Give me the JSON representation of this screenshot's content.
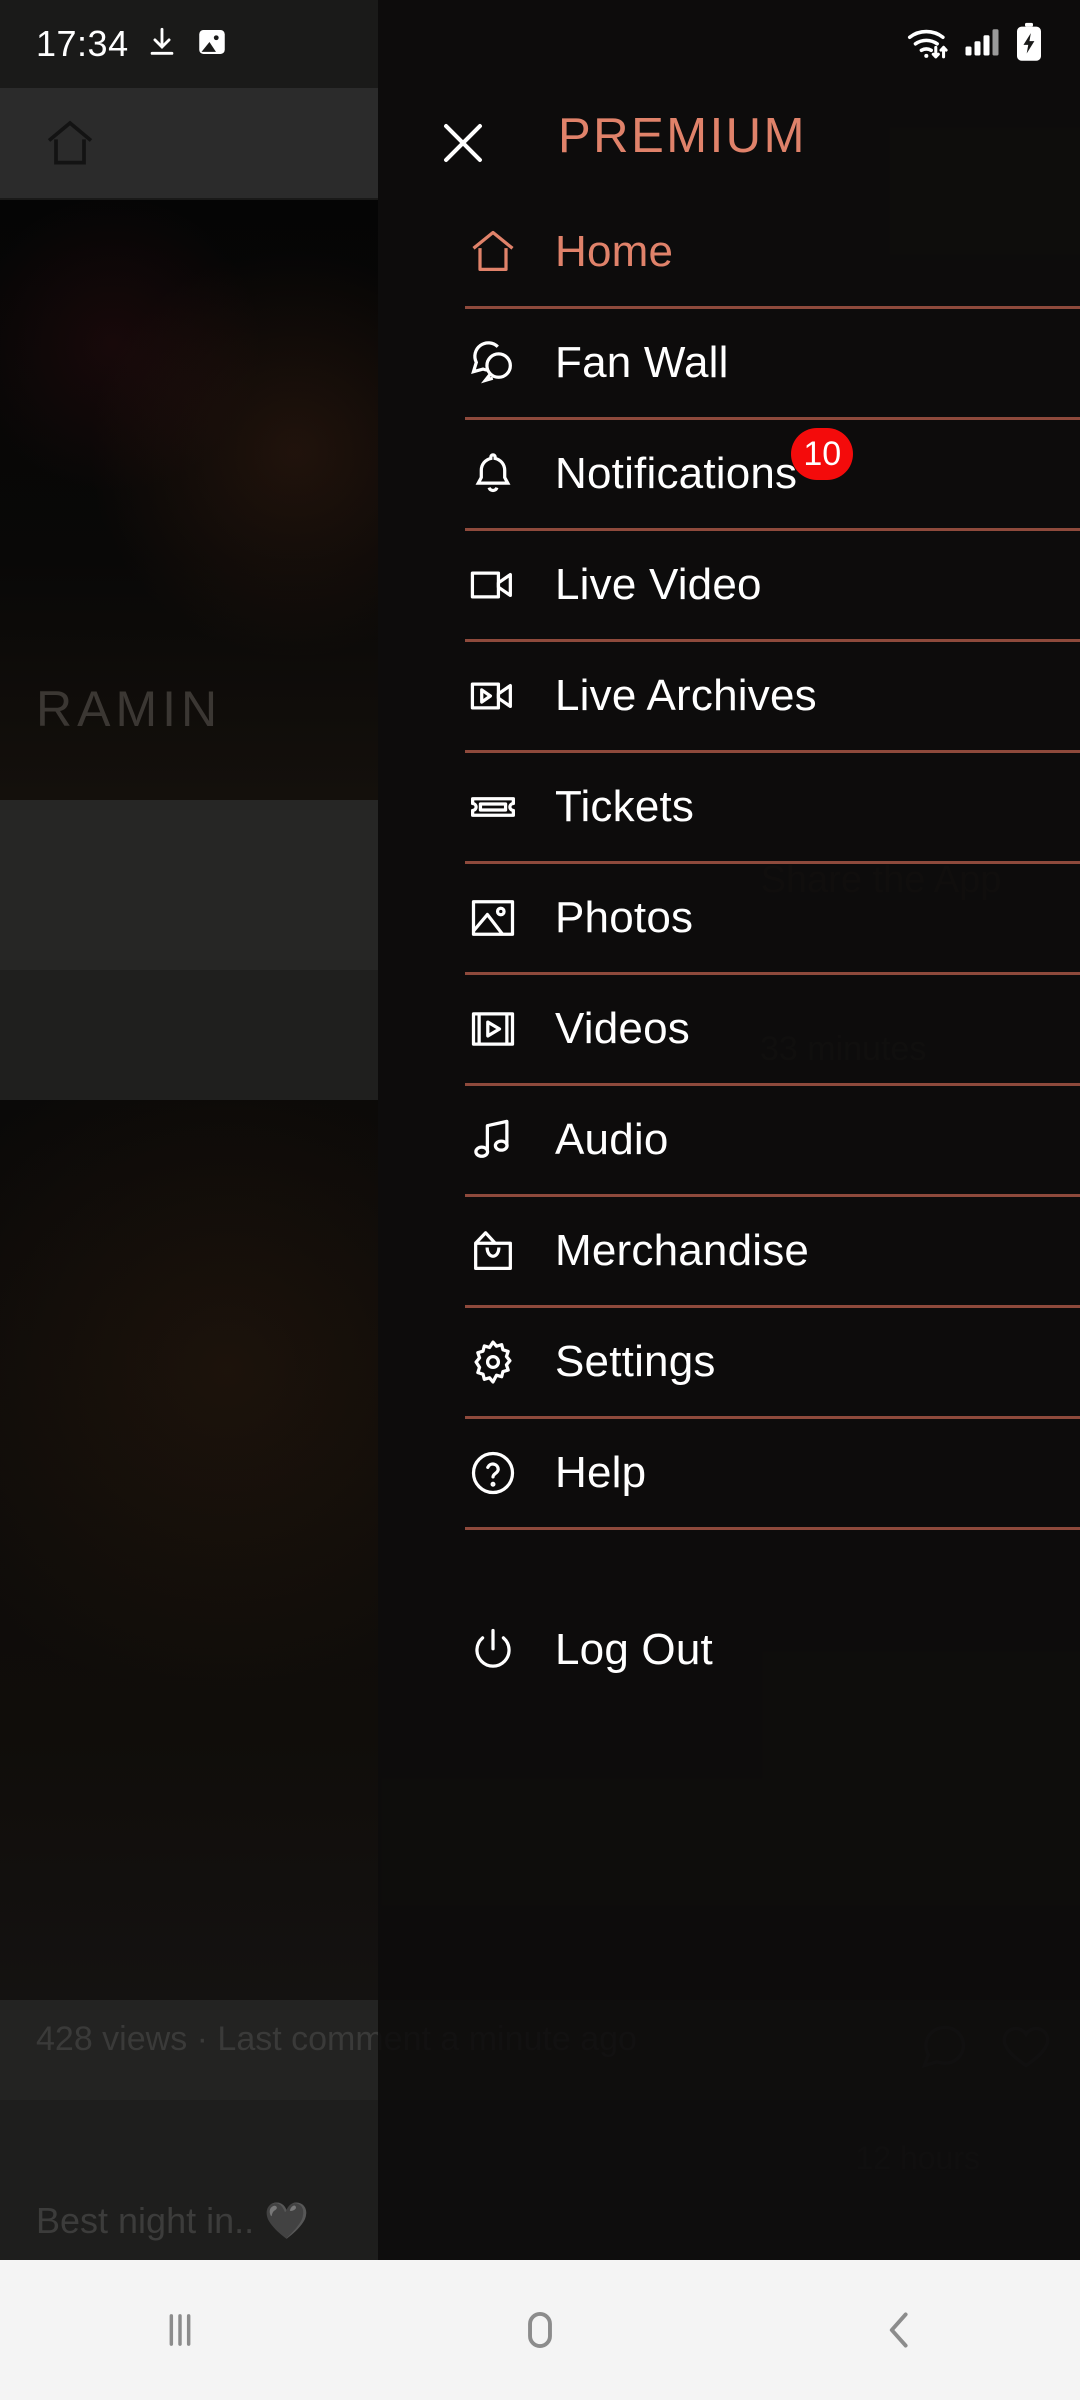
{
  "status_bar": {
    "time": "17:34",
    "icons": [
      "download-icon",
      "image-icon",
      "wifi-icon",
      "signal-icon",
      "battery-charging-icon"
    ]
  },
  "drawer": {
    "title": "PREMIUM",
    "close_label": "close-icon",
    "accent_color": "#e0826a",
    "divider_color": "#8e4a3c",
    "badge_color": "#f40b0b",
    "items": [
      {
        "label": "Home",
        "icon": "home-icon",
        "active": true,
        "badge": ""
      },
      {
        "label": "Fan Wall",
        "icon": "chat-bubbles-icon",
        "active": false,
        "badge": ""
      },
      {
        "label": "Notifications",
        "icon": "bell-icon",
        "active": false,
        "badge": "10"
      },
      {
        "label": "Live Video",
        "icon": "video-camera-icon",
        "active": false,
        "badge": ""
      },
      {
        "label": "Live Archives",
        "icon": "video-archive-icon",
        "active": false,
        "badge": ""
      },
      {
        "label": "Tickets",
        "icon": "ticket-icon",
        "active": false,
        "badge": ""
      },
      {
        "label": "Photos",
        "icon": "photo-icon",
        "active": false,
        "badge": ""
      },
      {
        "label": "Videos",
        "icon": "film-play-icon",
        "active": false,
        "badge": ""
      },
      {
        "label": "Audio",
        "icon": "music-note-icon",
        "active": false,
        "badge": ""
      },
      {
        "label": "Merchandise",
        "icon": "shopping-bag-icon",
        "active": false,
        "badge": ""
      },
      {
        "label": "Settings",
        "icon": "gear-icon",
        "active": false,
        "badge": ""
      },
      {
        "label": "Help",
        "icon": "question-circle-icon",
        "active": false,
        "badge": ""
      }
    ],
    "logout": {
      "label": "Log Out",
      "icon": "power-icon"
    }
  },
  "background": {
    "artist_name": "RAMIN",
    "share_label": "Share the App",
    "duration": "33 minutes",
    "post_meta": "428 views · Last comment a minute ago",
    "post_caption": "Best night in.. 🖤",
    "post_time": "12 hours",
    "home_icon": "home-icon"
  },
  "nav_bar": {
    "recents": "recents-icon",
    "home": "home-button-icon",
    "back": "back-icon"
  }
}
